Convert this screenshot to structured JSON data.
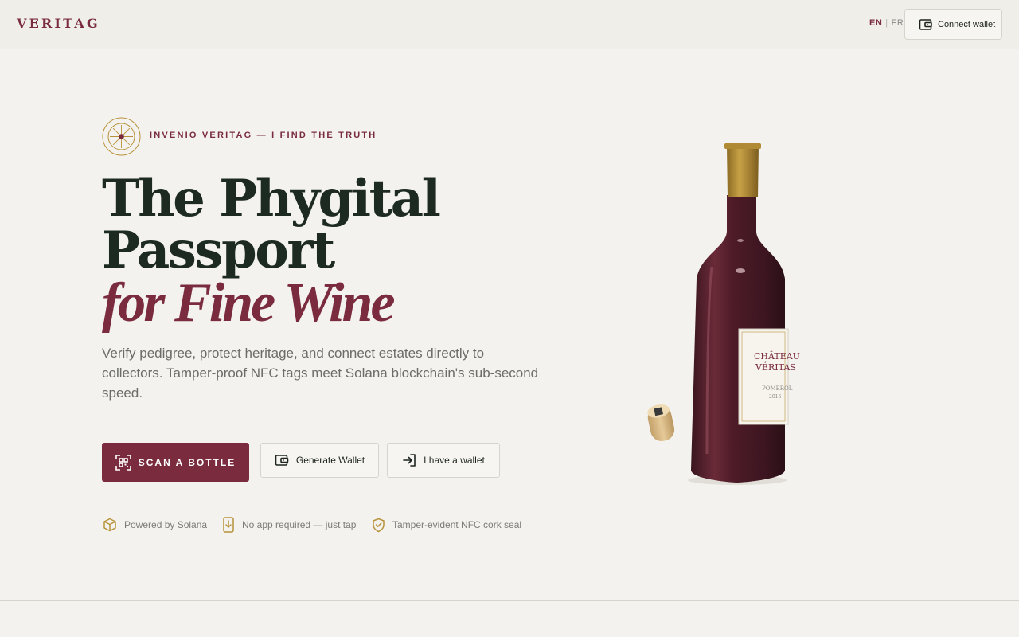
{
  "header": {
    "brand": "VERITAG",
    "lang_en": "EN",
    "lang_sep": "|",
    "lang_fr": "FR",
    "connect_label": "Connect wallet"
  },
  "hero": {
    "eyebrow": "INVENIO VERITAG — I FIND THE TRUTH",
    "title_line1": "The Phygital",
    "title_line2": "Passport",
    "title_line3": "for Fine Wine",
    "lede": "Verify pedigree, protect heritage, and connect estates directly to collectors. Tamper-proof NFC tags meet Solana blockchain's sub-second speed.",
    "primary_cta": "SCAN A BOTTLE",
    "generate_wallet": "Generate Wallet",
    "have_wallet": "I have a wallet"
  },
  "features": [
    {
      "icon": "cube-icon",
      "label": "Powered by Solana"
    },
    {
      "icon": "phone-tap-icon",
      "label": "No app required — just tap"
    },
    {
      "icon": "shield-check-icon",
      "label": "Tamper-evident NFC cork seal"
    }
  ],
  "bottle_label": {
    "line1": "CHÂTEAU",
    "line2": "VÉRITAS",
    "line3": "POMEROL",
    "line4": "2016"
  },
  "colors": {
    "background": "#f3f2ee",
    "brand_burgundy": "#7a2b3e",
    "headline_dark": "#1c2a21",
    "gold": "#b8923a"
  }
}
